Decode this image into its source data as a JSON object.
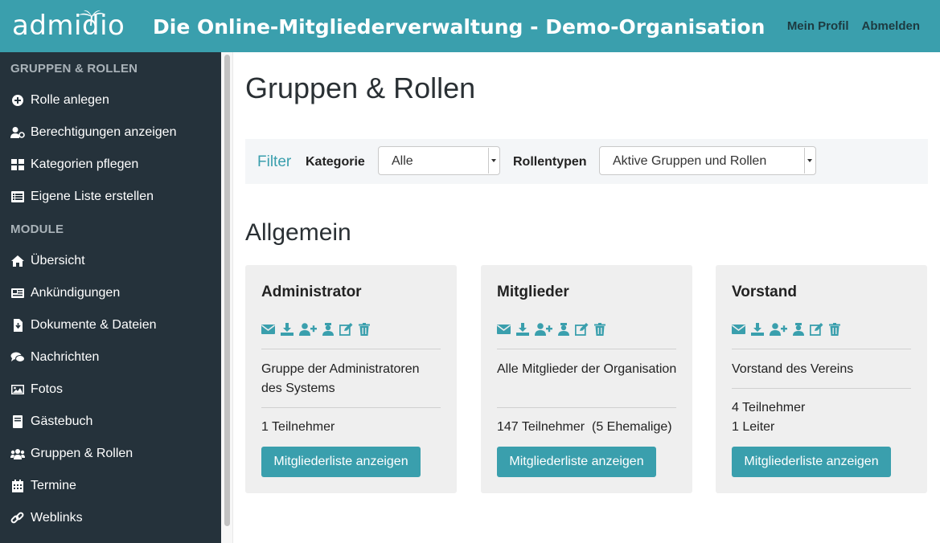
{
  "header": {
    "logo_text": "admidio",
    "title": "Die Online-Mitgliederverwaltung - Demo-Organisation",
    "profile_link": "Mein Profil",
    "logout_link": "Abmelden"
  },
  "sidebar": {
    "heading_groups": "GRUPPEN & ROLLEN",
    "group_items": [
      {
        "label": "Rolle anlegen",
        "icon": "plus-circle-icon"
      },
      {
        "label": "Berechtigungen anzeigen",
        "icon": "user-key-icon"
      },
      {
        "label": "Kategorien pflegen",
        "icon": "grid-icon"
      },
      {
        "label": "Eigene Liste erstellen",
        "icon": "list-icon"
      }
    ],
    "heading_modules": "MODULE",
    "module_items": [
      {
        "label": "Übersicht",
        "icon": "home-icon"
      },
      {
        "label": "Ankündigungen",
        "icon": "newspaper-icon"
      },
      {
        "label": "Dokumente & Dateien",
        "icon": "file-download-icon"
      },
      {
        "label": "Nachrichten",
        "icon": "comments-icon"
      },
      {
        "label": "Fotos",
        "icon": "image-icon"
      },
      {
        "label": "Gästebuch",
        "icon": "book-icon"
      },
      {
        "label": "Gruppen & Rollen",
        "icon": "users-icon"
      },
      {
        "label": "Termine",
        "icon": "calendar-icon"
      },
      {
        "label": "Weblinks",
        "icon": "link-icon"
      }
    ]
  },
  "main": {
    "page_title": "Gruppen & Rollen",
    "filter": {
      "label": "Filter",
      "category_label": "Kategorie",
      "category_value": "Alle",
      "roletype_label": "Rollentypen",
      "roletype_value": "Aktive Gruppen und Rollen"
    },
    "section_title": "Allgemein",
    "cards": [
      {
        "title": "Administrator",
        "description": "Gruppe der Administratoren des Systems",
        "stats": "1 Teilnehmer",
        "button": "Mitgliederliste anzeigen"
      },
      {
        "title": "Mitglieder",
        "description": "Alle Mitglieder der Organisation",
        "stats": "147 Teilnehmer  (5 Ehemalige)",
        "button": "Mitgliederliste anzeigen"
      },
      {
        "title": "Vorstand",
        "description": "Vorstand des Vereins",
        "stats": "4 Teilnehmer\n1 Leiter",
        "button": "Mitgliederliste anzeigen"
      }
    ],
    "card_icons": [
      "envelope-icon",
      "download-icon",
      "user-plus-icon",
      "leaders-icon",
      "edit-icon",
      "trash-icon"
    ]
  },
  "colors": {
    "brand": "#3a9fad",
    "sidebar_bg": "#25323b",
    "card_bg": "#efefef",
    "filter_bg": "#f4f6f8"
  }
}
